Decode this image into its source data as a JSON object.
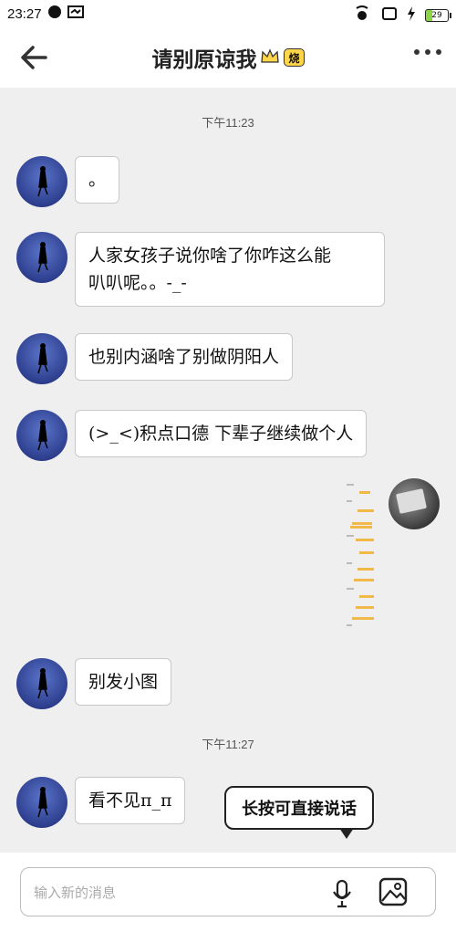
{
  "status_bar": {
    "time": "23:27",
    "battery": "29"
  },
  "nav": {
    "title": "请别原谅我",
    "badge": "烧"
  },
  "timestamps": [
    "下午11:23",
    "下午11:27"
  ],
  "messages": [
    {
      "lines": [
        "。"
      ]
    },
    {
      "lines": [
        "人家女孩子说你啥了你咋这么能",
        "叭叭呢。。-_-"
      ]
    },
    {
      "lines": [
        "也别内涵啥了别做阴阳人"
      ]
    },
    {
      "lines": [
        "(>_<)积点口德 下辈子继续做个人"
      ]
    },
    {
      "lines": [
        "别发小图"
      ]
    },
    {
      "lines": [
        "看不见π_π"
      ]
    }
  ],
  "tooltip": "长按可直接说话",
  "input": {
    "placeholder": "输入新的消息"
  },
  "colors": {
    "badge": "#ffd54a",
    "background": "#efefef"
  }
}
